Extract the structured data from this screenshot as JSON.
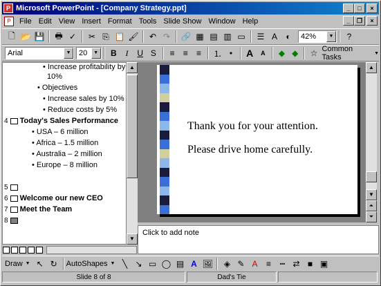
{
  "window": {
    "title": "Microsoft PowerPoint - [Company Strategy.ppt]"
  },
  "menu": [
    "File",
    "Edit",
    "View",
    "Insert",
    "Format",
    "Tools",
    "Slide Show",
    "Window",
    "Help"
  ],
  "toolbar": {
    "zoom": "42%",
    "font": "Arial",
    "font_size": "20",
    "common_tasks": "Common Tasks"
  },
  "outline": {
    "lines": [
      {
        "text": "Increase profitability by",
        "level": 2
      },
      {
        "text": "10%",
        "level": 2
      },
      {
        "text": "Objectives",
        "level": 1
      },
      {
        "text": "Increase sales by 10%",
        "level": 2
      },
      {
        "text": "Reduce costs by 5%",
        "level": 2
      }
    ],
    "slide4": {
      "num": "4",
      "title": "Today's Sales Performance"
    },
    "slide4_bullets": [
      "USA – 6 million",
      "Africa – 1.5 million",
      "Australia – 2 million",
      "Europe – 8 million"
    ],
    "slide5": {
      "num": "5"
    },
    "slide6": {
      "num": "6",
      "title": "Welcome our new CEO"
    },
    "slide7": {
      "num": "7",
      "title": "Meet the Team"
    },
    "slide8": {
      "num": "8"
    }
  },
  "slide": {
    "line1": "Thank you for your attention.",
    "line2": "Please drive home carefully.",
    "stripe_colors": [
      "#1a1a3a",
      "#3b6fd8",
      "#8fb6e8",
      "#cfcfa0",
      "#1a1a3a",
      "#3b6fd8",
      "#8fb6e8",
      "#1a1a3a",
      "#3b6fd8",
      "#cfcfa0",
      "#8fb6e8",
      "#1a1a3a",
      "#3b6fd8",
      "#8fb6e8",
      "#1a1a3a",
      "#3b6fd8"
    ]
  },
  "notes": {
    "placeholder": "Click to add note"
  },
  "drawbar": {
    "draw": "Draw",
    "autoshapes": "AutoShapes"
  },
  "status": {
    "slide": "Slide 8 of 8",
    "design": "Dad's Tie"
  }
}
